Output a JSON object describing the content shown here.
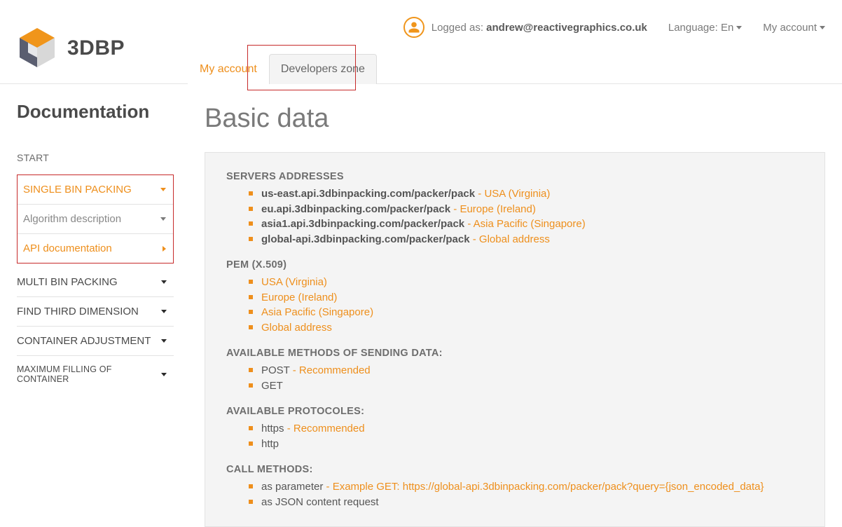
{
  "header": {
    "logo_text": "3DBP",
    "tabs": {
      "account": "My account",
      "dev": "Developers zone"
    },
    "logged_label": "Logged as:",
    "logged_email": "andrew@reactivegraphics.co.uk",
    "language_label": "Language: En",
    "my_account_label": "My account"
  },
  "sidebar": {
    "title": "Documentation",
    "start": "START",
    "single_bin": "SINGLE BIN PACKING",
    "algo_desc": "Algorithm description",
    "api_doc": "API documentation",
    "multi_bin": "MULTI BIN PACKING",
    "find_third": "FIND THIRD DIMENSION",
    "container_adj": "CONTAINER ADJUSTMENT",
    "max_fill": "MAXIMUM FILLING OF CONTAINER"
  },
  "main": {
    "title": "Basic data",
    "s_servers": "SERVERS ADDRESSES",
    "servers": [
      {
        "addr": "us-east.api.3dbinpacking.com/packer/pack",
        "loc": "- USA (Virginia)"
      },
      {
        "addr": "eu.api.3dbinpacking.com/packer/pack",
        "loc": "- Europe (Ireland)"
      },
      {
        "addr": "asia1.api.3dbinpacking.com/packer/pack",
        "loc": "- Asia Pacific (Singapore)"
      },
      {
        "addr": "global-api.3dbinpacking.com/packer/pack",
        "loc": "- Global address"
      }
    ],
    "s_pem": "PEM (X.509)",
    "pem": [
      "USA (Virginia)",
      "Europe (Ireland)",
      "Asia Pacific (Singapore)",
      "Global address"
    ],
    "s_methods": "AVAILABLE METHODS OF SENDING DATA:",
    "post": "POST",
    "get": "GET",
    "recommended": "- Recommended",
    "s_protocols": "AVAILABLE PROTOCOLES:",
    "https": "https",
    "http": "http",
    "s_call": "CALL METHODS:",
    "call_param": "as parameter",
    "call_param_ex": "- Example GET: https://global-api.3dbinpacking.com/packer/pack?query={json_encoded_data}",
    "call_json": "as JSON content request"
  }
}
